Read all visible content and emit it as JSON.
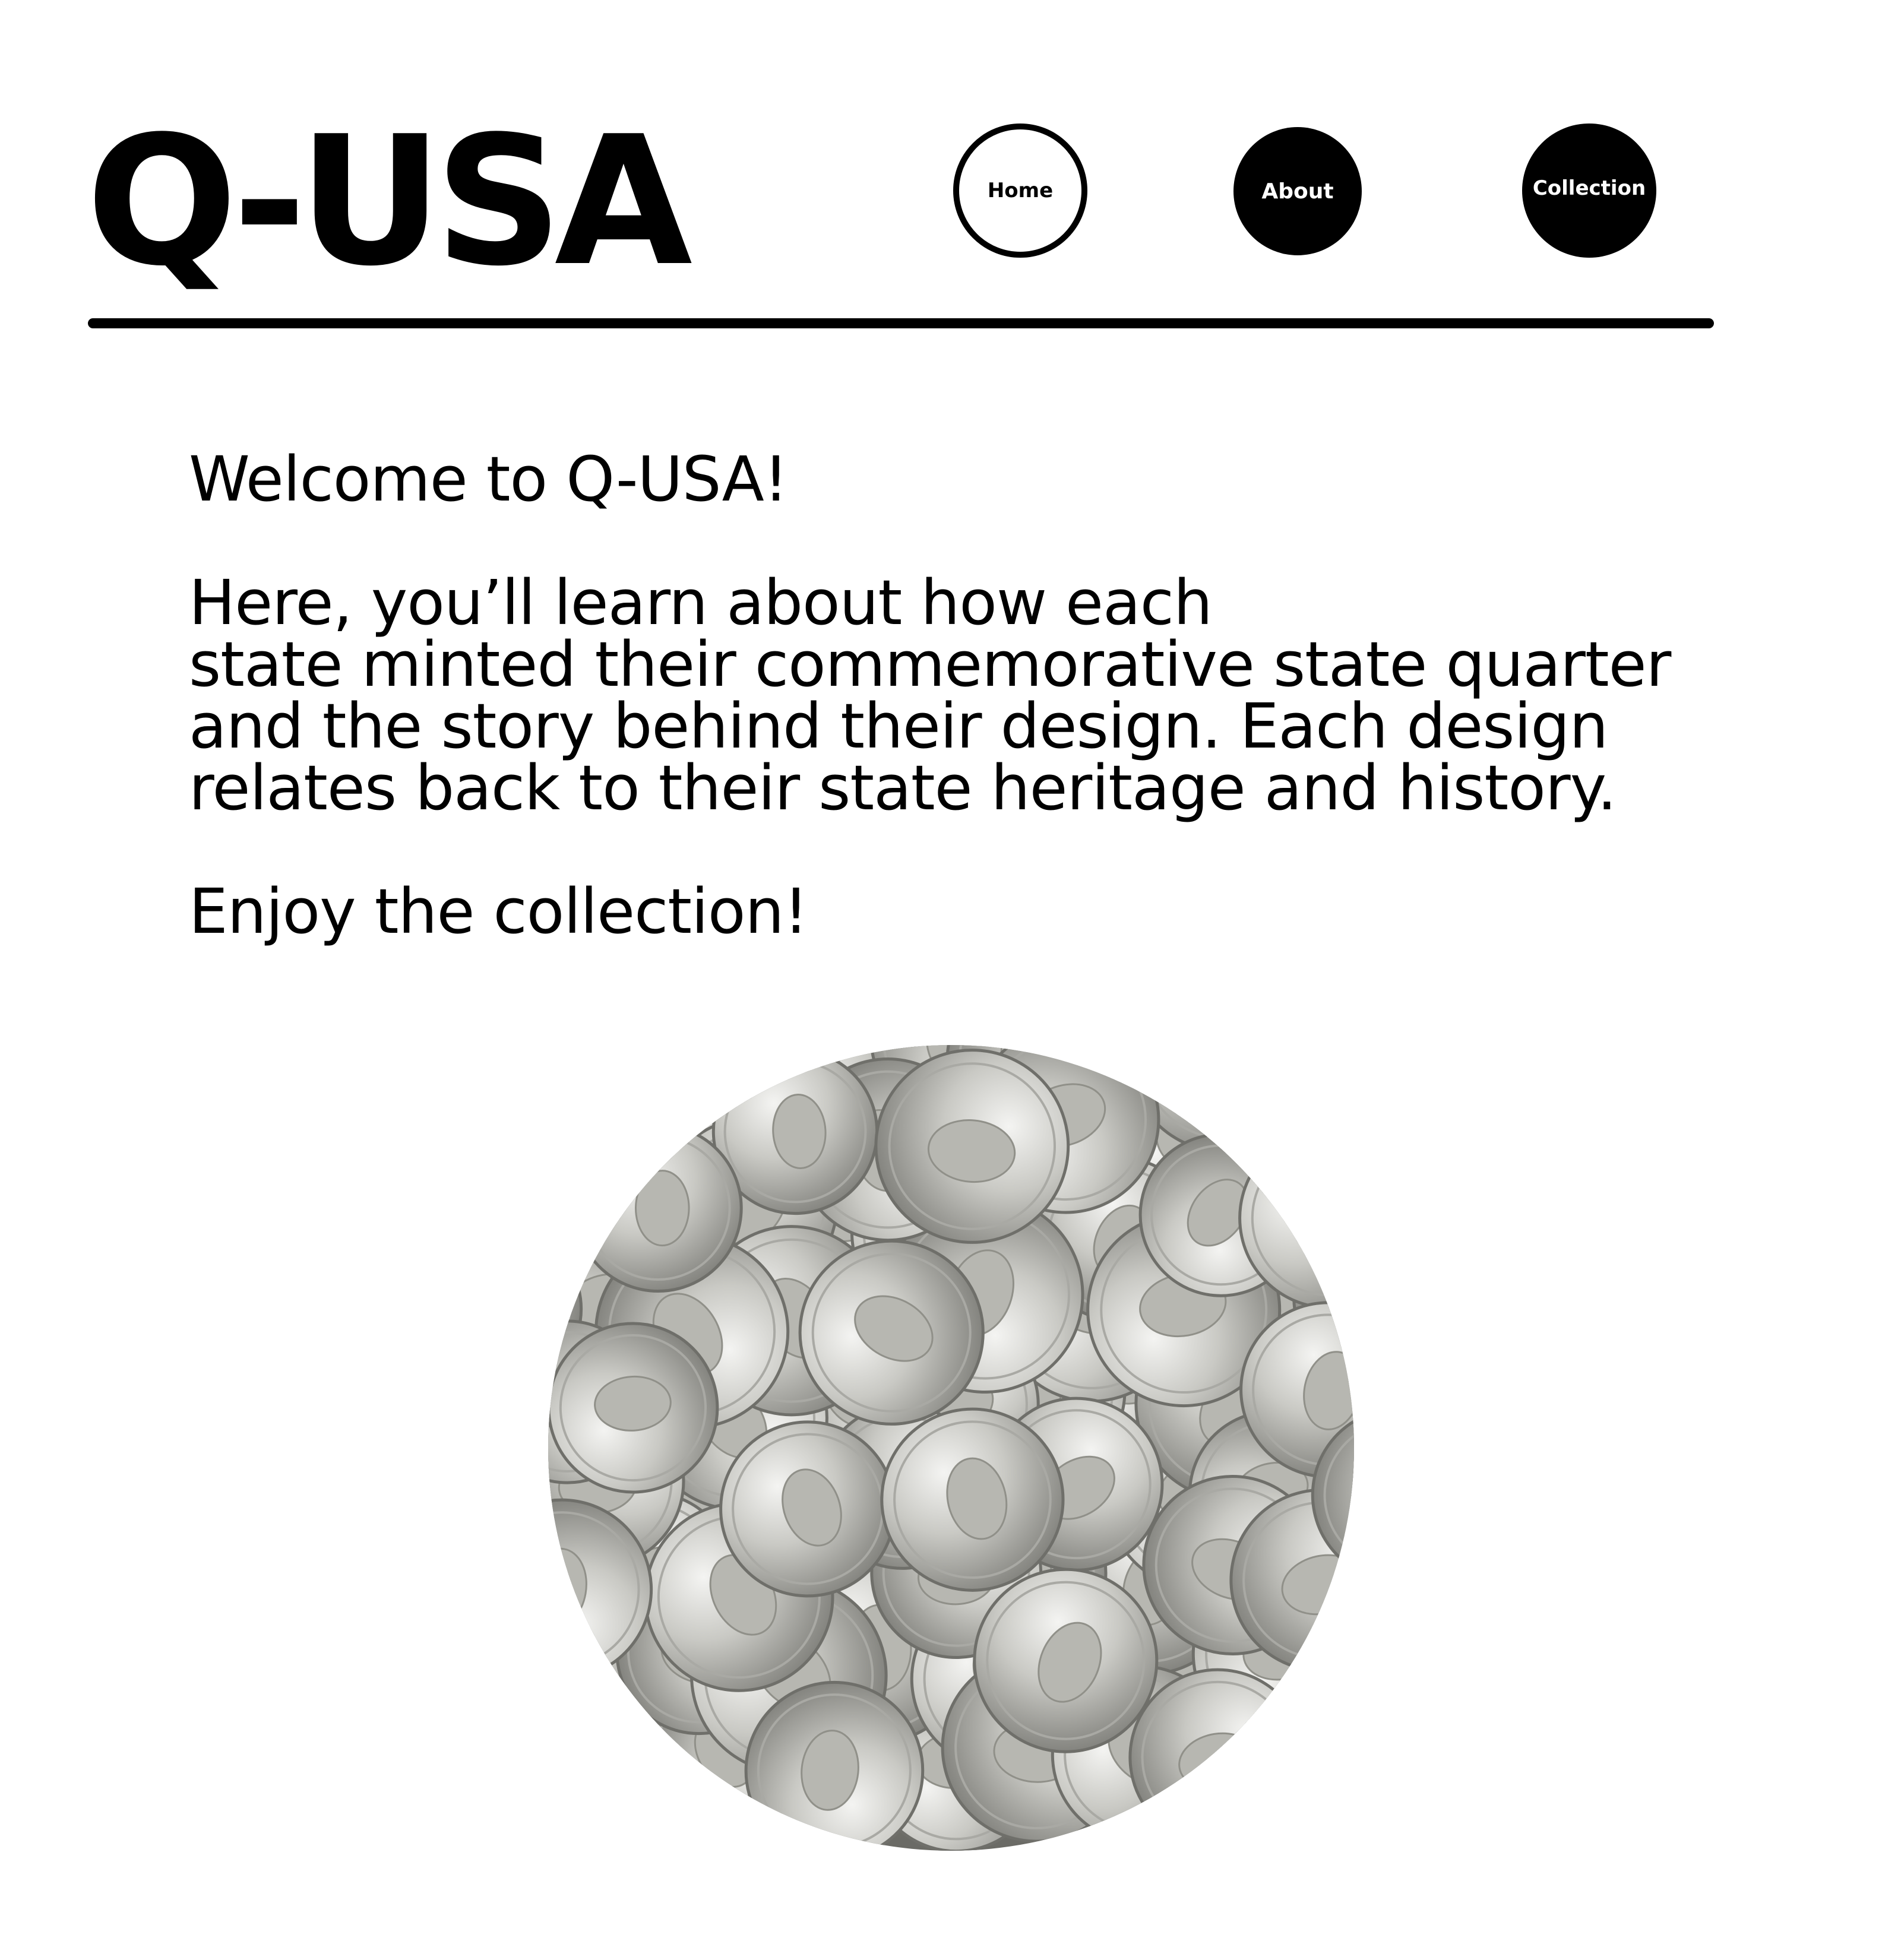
{
  "header": {
    "logo": "Q-USA",
    "nav": [
      {
        "label": "Home",
        "active": true
      },
      {
        "label": "About",
        "active": false
      },
      {
        "label": "Collection",
        "active": false
      }
    ]
  },
  "main": {
    "welcome": "Welcome to Q-USA!",
    "description_lines": [
      "Here, you’ll learn about how each",
      "state minted their commemorative state quarter",
      "and the story behind their design. Each design",
      "relates back to their state heritage and history."
    ],
    "closing": "Enjoy the collection!"
  },
  "hero_image": {
    "subject": "pile of US state quarters",
    "shape": "circle"
  },
  "colors": {
    "background": "#ffffff",
    "text": "#000000",
    "nav_fill": "#000000",
    "nav_active_fill": "#ffffff"
  }
}
